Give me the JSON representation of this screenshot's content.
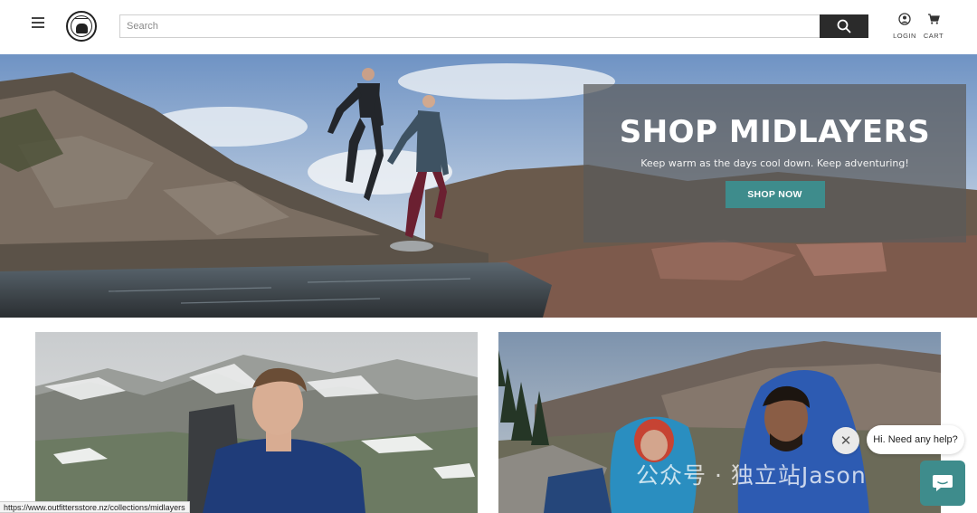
{
  "header": {
    "search_placeholder": "Search",
    "login_label": "LOGIN",
    "cart_label": "CART",
    "icons": [
      "menu-icon",
      "logo",
      "search-icon",
      "user-icon",
      "cart-icon"
    ]
  },
  "hero": {
    "title": "SHOP MIDLAYERS",
    "subtitle": "Keep warm as the days cool down. Keep adventuring!",
    "cta_label": "SHOP NOW",
    "accent_color": "#3e8c8c"
  },
  "chat": {
    "greeting": "Hi. Need any help?",
    "close_symbol": "✕"
  },
  "watermark": {
    "text": "公众号 · 独立站Jason"
  },
  "status_bar": {
    "url": "https://www.outfittersstore.nz/collections/midlayers"
  }
}
